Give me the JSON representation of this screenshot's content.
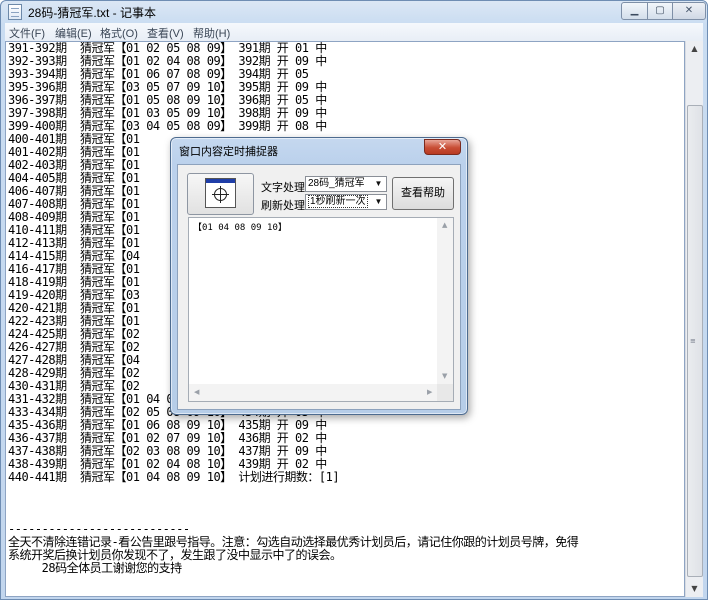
{
  "window": {
    "title": "28码-猜冠军.txt - 记事本"
  },
  "menu": [
    "文件(F)",
    "编辑(E)",
    "格式(O)",
    "查看(V)",
    "帮助(H)"
  ],
  "editor": {
    "content": "391-392期  猜冠军【01 02 05 08 09】 391期 开 01 中\n392-393期  猜冠军【01 02 04 08 09】 392期 开 09 中\n393-394期  猜冠军【01 06 07 08 09】 394期 开 05\n395-396期  猜冠军【03 05 07 09 10】 395期 开 09 中\n396-397期  猜冠军【01 05 08 09 10】 396期 开 05 中\n397-398期  猜冠军【01 03 05 09 10】 398期 开 09 中\n399-400期  猜冠军【03 04 05 08 09】 399期 开 08 中\n400-401期  猜冠军【01\n401-402期  猜冠军【01\n402-403期  猜冠军【01\n404-405期  猜冠军【01\n406-407期  猜冠军【01\n407-408期  猜冠军【01\n408-409期  猜冠军【01\n410-411期  猜冠军【01\n412-413期  猜冠军【01\n414-415期  猜冠军【04\n416-417期  猜冠军【01\n418-419期  猜冠军【01\n419-420期  猜冠军【03\n420-421期  猜冠军【01\n422-423期  猜冠军【01\n424-425期  猜冠军【02\n426-427期  猜冠军【02\n427-428期  猜冠军【04\n428-429期  猜冠军【02\n430-431期  猜冠军【02\n431-432期  猜冠军【01 04 06 08 09】 432期 开 03\n433-434期  猜冠军【02 05 08 09 10】 434期 开 05 中\n435-436期  猜冠军【01 06 08 09 10】 435期 开 09 中\n436-437期  猜冠军【01 02 07 09 10】 436期 开 02 中\n437-438期  猜冠军【02 03 08 09 10】 437期 开 09 中\n438-439期  猜冠军【01 02 04 08 10】 439期 开 02 中\n440-441期  猜冠军【01 04 08 09 10】 计划进行期数：[1]",
    "footer": "---------------------------\n全天不清除连错记录-看公告里跟号指导。注意：勾选自动选择最优秀计划员后，请记住你跟的计划员号牌，免得\n系统开奖后换计划员你发现不了，发生跟了没中显示中了的误会。\n     28码全体员工谢谢您的支持"
  },
  "dialog": {
    "title": "窗口内容定时捕捉器",
    "text_label": "文字处理",
    "text_value": "28码_猜冠军",
    "refresh_label": "刷新处理",
    "refresh_value": "1秒刷新一次",
    "help_button": "查看帮助",
    "captured": "【01 04 08 09 10】"
  }
}
